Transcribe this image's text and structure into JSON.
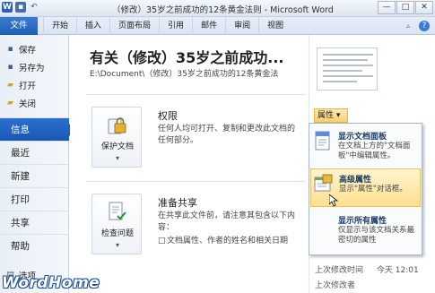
{
  "window": {
    "title": "（修改）35岁之前成功的12条黄金法则 - Microsoft Word",
    "qat_icons": [
      "word-icon",
      "save-icon",
      "undo-icon"
    ],
    "controls": [
      "—",
      "□",
      "✕"
    ]
  },
  "ribbon": {
    "file_tab": "文件",
    "tabs": [
      "开始",
      "插入",
      "页面布局",
      "引用",
      "邮件",
      "审阅",
      "视图"
    ]
  },
  "nav": {
    "small_items": [
      {
        "label": "保存",
        "icon": "save-icon"
      },
      {
        "label": "另存为",
        "icon": "save-as-icon"
      },
      {
        "label": "打开",
        "icon": "open-folder-icon"
      },
      {
        "label": "关闭",
        "icon": "close-doc-icon"
      }
    ],
    "big_items": [
      "信息",
      "最近",
      "新建",
      "打印",
      "共享",
      "帮助"
    ],
    "active": "信息",
    "options": {
      "label": "选项",
      "icon": "options-icon"
    }
  },
  "main": {
    "doc_title": "有关（修改）35岁之前成功...",
    "doc_path": "E:\\Document\\（修改）35岁之前成功的12条黄金法",
    "permissions": {
      "button_label": "保护文档",
      "button_arrow": "▾",
      "title": "权限",
      "desc": "任何人均可打开、复制和更改此文档的任何部分。"
    },
    "share": {
      "button_label": "检查问题",
      "button_arrow": "▾",
      "title": "准备共享",
      "desc": "在共享此文件前，请注意其包含以下内容：",
      "bullet": "文档属性、作者的姓名和相关日期"
    }
  },
  "right_panel": {
    "properties_button": "属性 ▾",
    "rows": [
      {
        "label": "上次修改时间",
        "value": "今天 12:01"
      },
      {
        "label": "上次修改者",
        "value": ""
      }
    ]
  },
  "properties_menu": [
    {
      "title": "显示文档面板",
      "desc": "在文档上方的\"文档面板\"中编辑属性。",
      "icon": "document-panel-icon"
    },
    {
      "title": "高级属性",
      "desc": "显示\"属性\"对话框。",
      "icon": "advanced-properties-icon"
    },
    {
      "title": "显示所有属性",
      "desc": "仅显示与该文档关系最密切的属性",
      "icon": "all-properties-icon"
    }
  ],
  "watermark": "WordHome",
  "colors": {
    "accent": "#1f5eb8",
    "menu_hover": "#fde08e"
  }
}
